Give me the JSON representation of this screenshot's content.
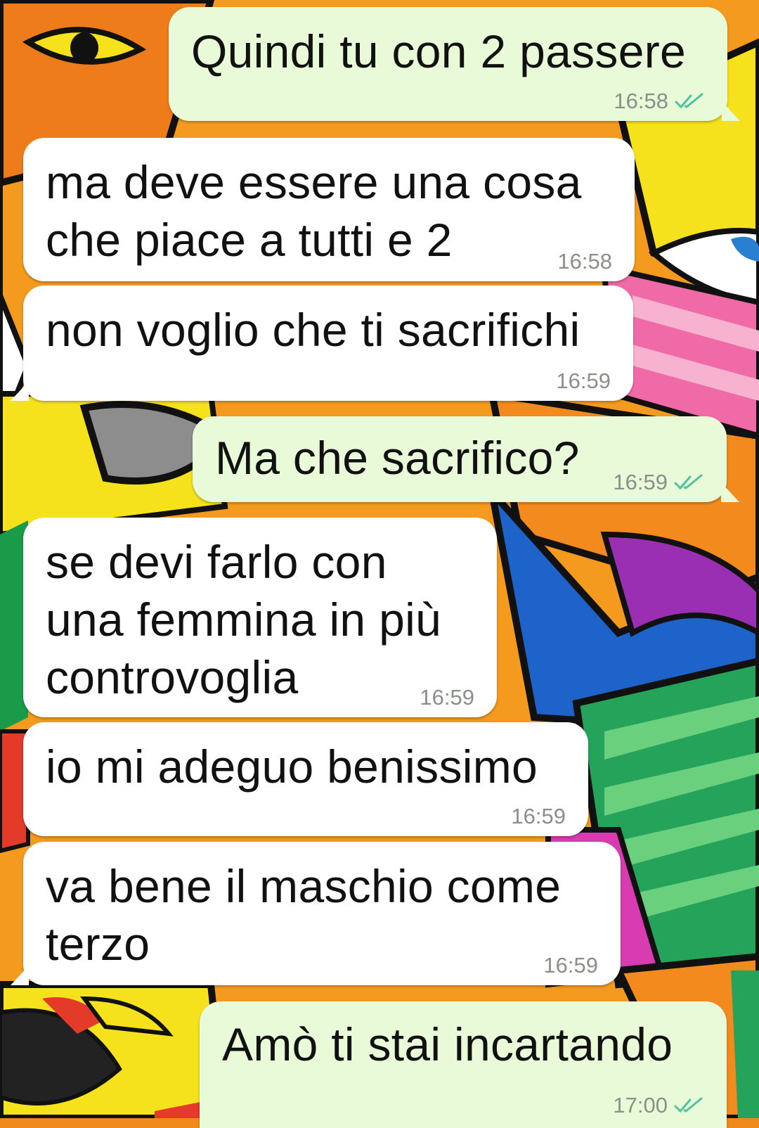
{
  "colors": {
    "incoming_bubble": "#ffffff",
    "outgoing_bubble": "#e9fad8",
    "read_tick": "#4fc3a1",
    "timestamp": "#8a8f8a"
  },
  "messages": [
    {
      "direction": "out",
      "text": "Quindi tu con 2 passere",
      "time": "16:58",
      "status_icon": "double-check-read"
    },
    {
      "direction": "in",
      "text": "ma deve essere una cosa\nche piace a tutti e 2",
      "time": "16:58"
    },
    {
      "direction": "in",
      "text": "non voglio che ti sacrifichi",
      "time": "16:59"
    },
    {
      "direction": "out",
      "text": "Ma che sacrifico?",
      "time": "16:59",
      "status_icon": "double-check-read"
    },
    {
      "direction": "in",
      "text": "se devi farlo con\nuna femmina in più\ncontrovoglia",
      "time": "16:59"
    },
    {
      "direction": "in",
      "text": "io mi adeguo benissimo",
      "time": "16:59"
    },
    {
      "direction": "in",
      "text": "va bene il maschio come\nterzo",
      "time": "16:59"
    },
    {
      "direction": "out",
      "text": "Amò ti stai incartando",
      "time": "17:00",
      "status_icon": "double-check-read"
    }
  ]
}
